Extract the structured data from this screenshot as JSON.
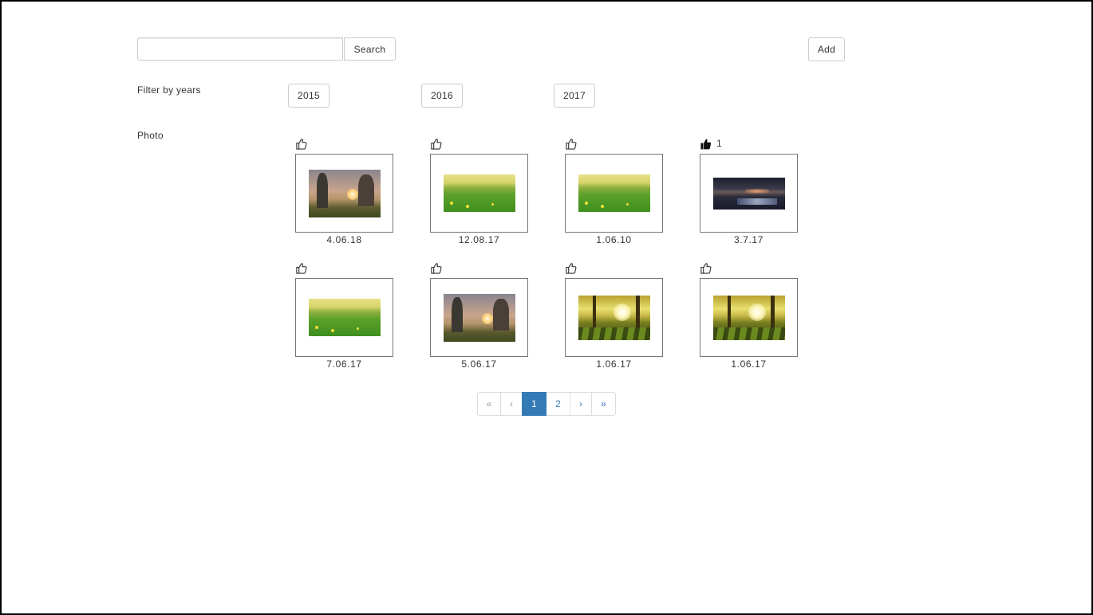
{
  "search": {
    "placeholder": "",
    "value": "",
    "button_label": "Search"
  },
  "add_label": "Add",
  "filter": {
    "label": "Filter by years",
    "years": [
      "2015",
      "2016",
      "2017"
    ]
  },
  "photo_label": "Photo",
  "photos": [
    {
      "date": "4.06.18",
      "likes": "",
      "liked": false,
      "scene": "sunset-trees"
    },
    {
      "date": "12.08.17",
      "likes": "",
      "liked": false,
      "scene": "green-meadow"
    },
    {
      "date": "1.06.10",
      "likes": "",
      "liked": false,
      "scene": "green-meadow"
    },
    {
      "date": "3.7.17",
      "likes": "1",
      "liked": true,
      "scene": "night-river"
    },
    {
      "date": "7.06.17",
      "likes": "",
      "liked": false,
      "scene": "green-meadow"
    },
    {
      "date": "5.06.17",
      "likes": "",
      "liked": false,
      "scene": "sunset-trees"
    },
    {
      "date": "1.06.17",
      "likes": "",
      "liked": false,
      "scene": "sunlit-forest"
    },
    {
      "date": "1.06.17",
      "likes": "",
      "liked": false,
      "scene": "sunlit-forest"
    }
  ],
  "pagination": {
    "first": "«",
    "prev": "‹",
    "pages": [
      "1",
      "2"
    ],
    "active": "1",
    "next": "›",
    "last": "»"
  },
  "colors": {
    "accent": "#337ab7",
    "border": "#cccccc",
    "card_border": "#777777"
  }
}
